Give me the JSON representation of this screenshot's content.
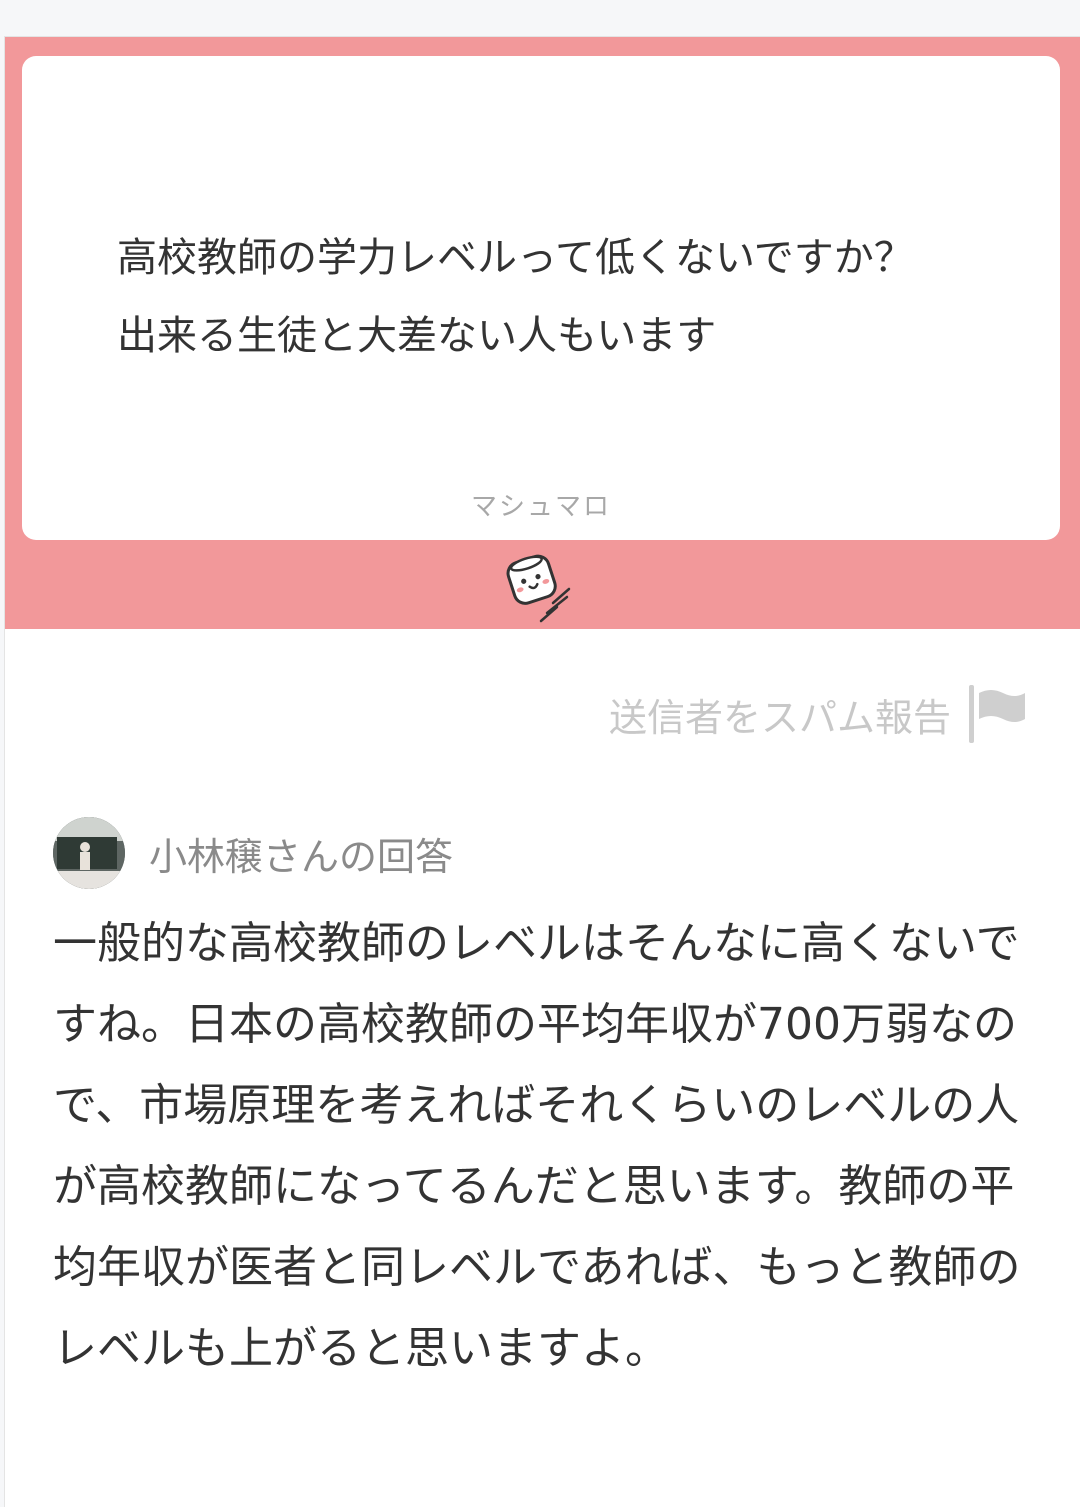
{
  "question": {
    "text": "高校教師の学力レベルって低くないですか？\n出来る生徒と大差ない人もいます",
    "brand": "マシュマロ"
  },
  "report": {
    "label": "送信者をスパム報告",
    "icon": "flag-icon"
  },
  "answer": {
    "title": "小林穣さんの回答",
    "body": "一般的な高校教師のレベルはそんなに高くないですね。日本の高校教師の平均年収が700万弱なので、市場原理を考えればそれくらいのレベルの人が高校教師になってるんだと思います。教師の平均年収が医者と同レベルであれば、もっと教師のレベルも上がると思いますよ。"
  },
  "colors": {
    "accent": "#f2989a",
    "text": "#333333",
    "muted": "#8a8a8a"
  }
}
